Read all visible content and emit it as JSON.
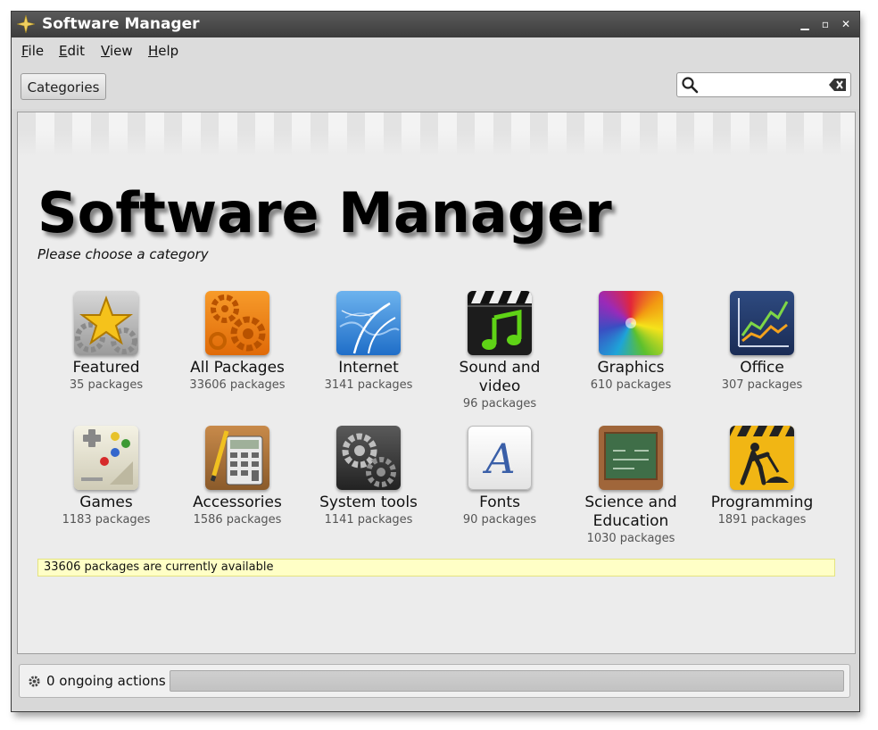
{
  "window": {
    "title": "Software Manager"
  },
  "menu": [
    {
      "label": "File",
      "mnemonic": "F",
      "rest": "ile"
    },
    {
      "label": "Edit",
      "mnemonic": "E",
      "rest": "dit"
    },
    {
      "label": "View",
      "mnemonic": "V",
      "rest": "iew"
    },
    {
      "label": "Help",
      "mnemonic": "H",
      "rest": "elp"
    }
  ],
  "toolbar": {
    "categories_label": "Categories",
    "search_value": "",
    "search_placeholder": ""
  },
  "main": {
    "title": "Software Manager",
    "subtitle": "Please choose a category",
    "categories": [
      {
        "name": "Featured",
        "count": "35 packages",
        "icon": "star-gears-icon"
      },
      {
        "name": "All Packages",
        "count": "33606 packages",
        "icon": "orange-gears-icon"
      },
      {
        "name": "Internet",
        "count": "3141 packages",
        "icon": "globe-network-icon"
      },
      {
        "name": "Sound and video",
        "count": "96 packages",
        "icon": "clapper-music-icon"
      },
      {
        "name": "Graphics",
        "count": "610 packages",
        "icon": "color-wheel-icon"
      },
      {
        "name": "Office",
        "count": "307 packages",
        "icon": "line-chart-icon"
      },
      {
        "name": "Games",
        "count": "1183 packages",
        "icon": "gamepad-icon"
      },
      {
        "name": "Accessories",
        "count": "1586 packages",
        "icon": "calculator-icon"
      },
      {
        "name": "System tools",
        "count": "1141 packages",
        "icon": "system-gears-icon"
      },
      {
        "name": "Fonts",
        "count": "90 packages",
        "icon": "font-letter-icon"
      },
      {
        "name": "Science and Education",
        "count": "1030 packages",
        "icon": "chalkboard-icon"
      },
      {
        "name": "Programming",
        "count": "1891 packages",
        "icon": "construction-sign-icon"
      }
    ],
    "available_notice": "33606 packages are currently available"
  },
  "status": {
    "ongoing_actions": "0 ongoing actions",
    "progress": 0
  },
  "colors": {
    "notice_bg": "#ffffc6",
    "titlebar": "#474747"
  }
}
